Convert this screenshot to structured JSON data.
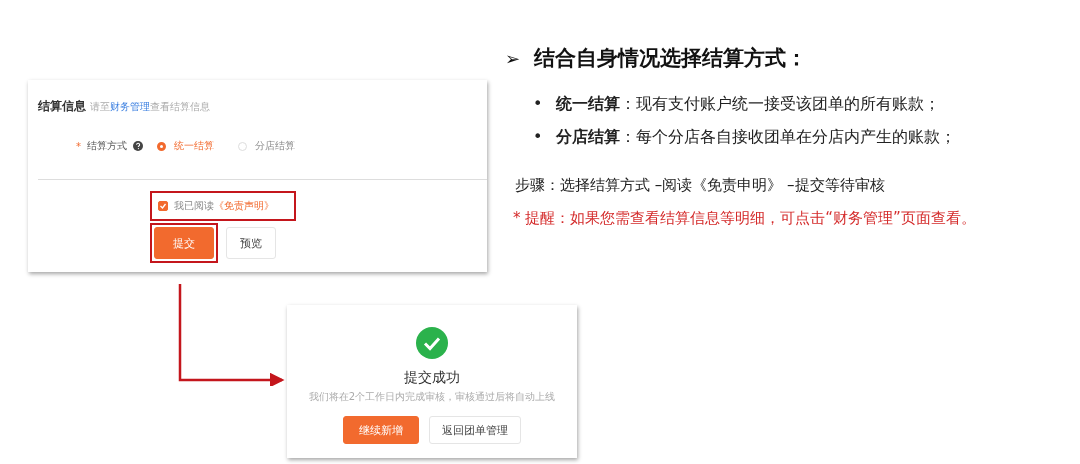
{
  "settlement_form": {
    "title": "结算信息",
    "hint_prefix": "请至",
    "hint_link": "财务管理",
    "hint_suffix": "查看结算信息",
    "required_mark": "*",
    "field_label": "结算方式",
    "options": [
      {
        "label": "统一结算",
        "selected": true
      },
      {
        "label": "分店结算",
        "selected": false
      }
    ],
    "agreement": {
      "checked": true,
      "text": "我已阅读",
      "link": "《免责声明》"
    },
    "buttons": [
      {
        "label": "提交",
        "kind": "primary"
      },
      {
        "label": "预览",
        "kind": "default"
      }
    ]
  },
  "success_panel": {
    "title": "提交成功",
    "message": "我们将在2个工作日内完成审核，审核通过后将自动上线",
    "buttons": [
      {
        "label": "继续新增",
        "kind": "primary"
      },
      {
        "label": "返回团单管理",
        "kind": "default"
      }
    ]
  },
  "notes": {
    "heading_marker": "➢",
    "heading": "结合自身情况选择结算方式：",
    "bullets": [
      {
        "marker": "•",
        "text": "**统一结算**：现有支付账户统一接受该团单的所有账款；"
      },
      {
        "marker": "•",
        "text": "**分店结算**：每个分店各自接收团单在分店内产生的账款；"
      }
    ],
    "steps": "步骤：选择结算方式 –阅读《免责申明》 –提交等待审核",
    "reminder": "* 提醒：如果您需查看结算信息等明细，可点击“财务管理”页面查看。"
  }
}
